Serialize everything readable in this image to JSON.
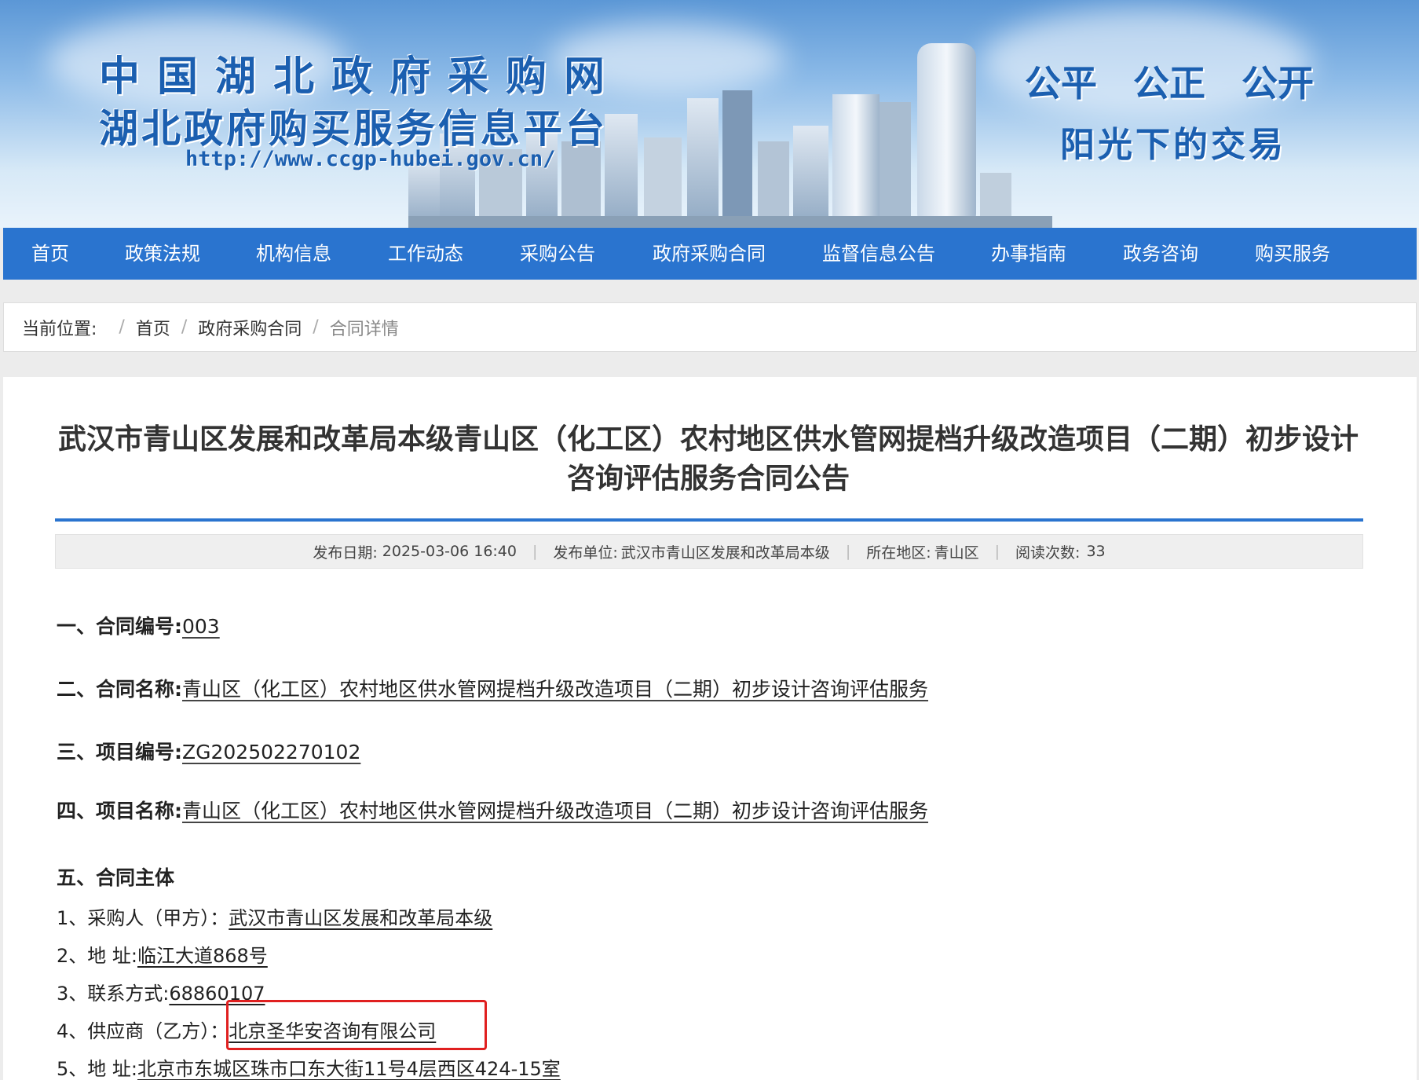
{
  "header": {
    "title": "中国湖北政府采购网",
    "subtitle": "湖北政府购买服务信息平台",
    "url": "http://www.ccgp-hubei.gov.cn/",
    "slogan_line1": "公平 公正 公开",
    "slogan_line2": "阳光下的交易"
  },
  "nav": {
    "items": [
      {
        "label": "首页"
      },
      {
        "label": "政策法规"
      },
      {
        "label": "机构信息"
      },
      {
        "label": "工作动态"
      },
      {
        "label": "采购公告"
      },
      {
        "label": "政府采购合同"
      },
      {
        "label": "监督信息公告"
      },
      {
        "label": "办事指南"
      },
      {
        "label": "政务咨询"
      },
      {
        "label": "购买服务"
      }
    ]
  },
  "breadcrumb": {
    "prefix": "当前位置:",
    "home": "首页",
    "section": "政府采购合同",
    "current": "合同详情",
    "separator": "/"
  },
  "article": {
    "title": "武汉市青山区发展和改革局本级青山区（化工区）农村地区供水管网提档升级改造项目（二期）初步设计咨询评估服务合同公告",
    "meta": {
      "date_label": "发布日期:",
      "date": "2025-03-06 16:40",
      "publisher_label": "发布单位:",
      "publisher": "武汉市青山区发展和改革局本级",
      "region_label": "所在地区:",
      "region": "青山区",
      "reads_label": "阅读次数:",
      "reads": "33"
    },
    "fields": [
      {
        "label": "一、合同编号:",
        "value": "003"
      },
      {
        "label": "二、合同名称:",
        "value": "青山区（化工区）农村地区供水管网提档升级改造项目（二期）初步设计咨询评估服务"
      },
      {
        "label": "三、项目编号:",
        "value": "ZG202502270102"
      },
      {
        "label": "四、项目名称:",
        "value": "青山区（化工区）农村地区供水管网提档升级改造项目（二期）初步设计咨询评估服务"
      }
    ],
    "section5": {
      "heading": "五、合同主体",
      "parties": [
        {
          "label": "1、采购人（甲方）：",
          "value": "武汉市青山区发展和改革局本级"
        },
        {
          "label": "2、地 址:",
          "value": "临江大道868号"
        },
        {
          "label": "3、联系方式:",
          "value": "68860107"
        },
        {
          "label": "4、供应商（乙方）：",
          "value": "北京圣华安咨询有限公司"
        },
        {
          "label": "5、地 址:",
          "value": "北京市东城区珠市口东大街11号4层西区424-15室"
        }
      ]
    }
  },
  "colors": {
    "nav_bg": "#2a74cf",
    "brand_text": "#1b5fb0",
    "highlight": "#e02020"
  }
}
